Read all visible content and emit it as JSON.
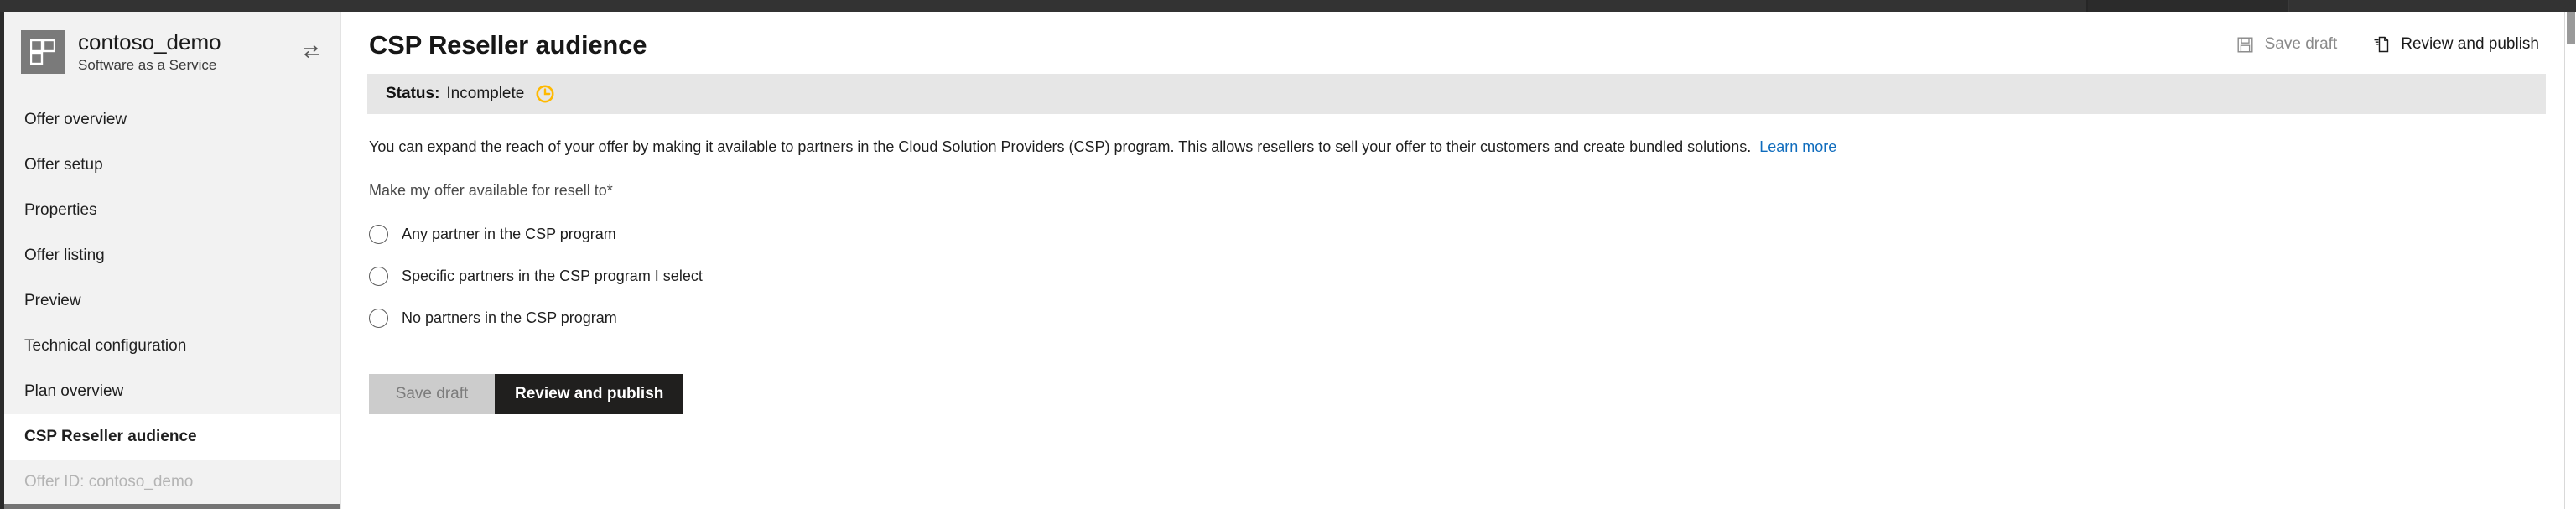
{
  "sidebar": {
    "offer": {
      "icon": "offer-blocks-icon",
      "name": "contoso_demo",
      "subtitle": "Software as a Service",
      "switch_icon": "switch-offer-icon"
    },
    "items": [
      {
        "label": "Offer overview",
        "selected": false,
        "muted": false
      },
      {
        "label": "Offer setup",
        "selected": false,
        "muted": false
      },
      {
        "label": "Properties",
        "selected": false,
        "muted": false
      },
      {
        "label": "Offer listing",
        "selected": false,
        "muted": false
      },
      {
        "label": "Preview",
        "selected": false,
        "muted": false
      },
      {
        "label": "Technical configuration",
        "selected": false,
        "muted": false
      },
      {
        "label": "Plan overview",
        "selected": false,
        "muted": false
      },
      {
        "label": "CSP Reseller audience",
        "selected": true,
        "muted": false
      },
      {
        "label": "Offer ID: contoso_demo",
        "selected": false,
        "muted": true
      }
    ]
  },
  "main": {
    "title": "CSP Reseller audience",
    "commands": [
      {
        "label": "Save draft",
        "icon": "save-icon",
        "enabled": false
      },
      {
        "label": "Review and publish",
        "icon": "review-publish-icon",
        "enabled": true
      }
    ],
    "status": {
      "label": "Status:",
      "value": "Incomplete",
      "icon": "pending-clock-icon",
      "icon_color": "#ffb900",
      "banner_color": "#e6e6e6"
    },
    "description": {
      "text": "You can expand the reach of your offer by making it available to partners in the Cloud Solution Providers (CSP) program. This allows resellers to sell your offer to their customers and create bundled solutions.",
      "link_text": "Learn more",
      "link_color": "#0f6cbd"
    },
    "field": {
      "label": "Make my offer available for resell to",
      "required_marker": "*",
      "options": [
        {
          "label": "Any partner in the CSP program",
          "checked": false
        },
        {
          "label": "Specific partners in the CSP program I select",
          "checked": false
        },
        {
          "label": "No partners in the CSP program",
          "checked": false
        }
      ]
    },
    "buttons": [
      {
        "label": "Save draft",
        "kind": "secondary",
        "enabled": false
      },
      {
        "label": "Review and publish",
        "kind": "primary",
        "enabled": true
      }
    ]
  }
}
